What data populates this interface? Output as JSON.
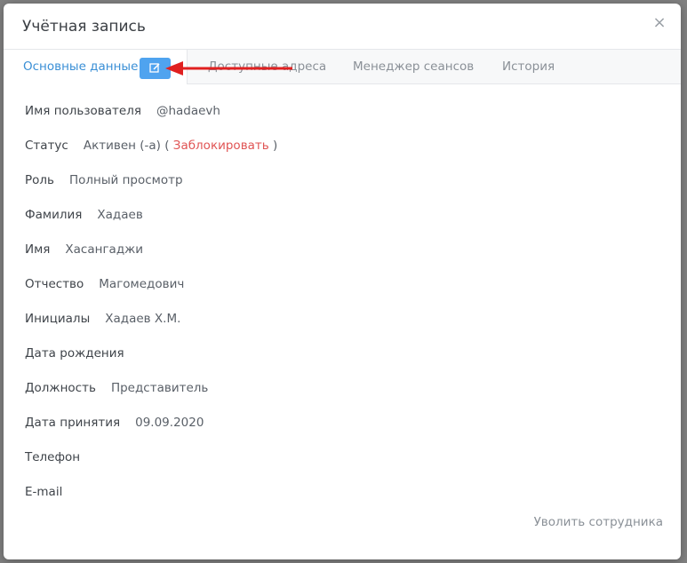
{
  "dialog": {
    "title": "Учётная запись",
    "close_glyph": "×",
    "close_icon": "close-icon"
  },
  "tabs": [
    {
      "label": "Основные данные",
      "active": true
    },
    {
      "label": "Доступные адреса",
      "active": false
    },
    {
      "label": "Менеджер сеансов",
      "active": false
    },
    {
      "label": "История",
      "active": false
    }
  ],
  "edit_button": {
    "icon": "edit-icon",
    "color": "#4fa3ef"
  },
  "annotation_arrow": {
    "color": "#e02020",
    "icon": "arrow-left-icon"
  },
  "fields": [
    {
      "label": "Имя пользователя",
      "value": "@hadaevh"
    },
    {
      "label": "Статус",
      "value": "Активен (-а) (",
      "link": "Заблокировать",
      "suffix": ")"
    },
    {
      "label": "Роль",
      "value": "Полный просмотр"
    },
    {
      "label": "Фамилия",
      "value": "Хадаев"
    },
    {
      "label": "Имя",
      "value": "Хасангаджи"
    },
    {
      "label": "Отчество",
      "value": "Магомедович"
    },
    {
      "label": "Инициалы",
      "value": "Хадаев Х.М."
    },
    {
      "label": "Дата рождения",
      "value": ""
    },
    {
      "label": "Должность",
      "value": "Представитель"
    },
    {
      "label": "Дата принятия",
      "value": "09.09.2020"
    },
    {
      "label": "Телефон",
      "value": ""
    },
    {
      "label": "E-mail",
      "value": ""
    }
  ],
  "footer": {
    "dismiss_label": "Уволить сотрудника"
  },
  "colors": {
    "accent": "#3a8fd6",
    "danger": "#e05454"
  }
}
